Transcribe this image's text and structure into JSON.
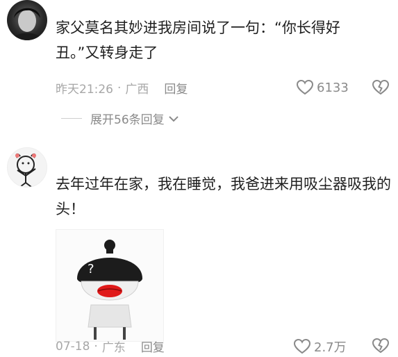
{
  "comments": [
    {
      "text": "家父莫名其妙进我房间说了一句：“你长得好丑。”又转身走了",
      "time": "昨天21:26",
      "location": "广西",
      "reply_label": "回复",
      "likes": "6133",
      "expand_replies": "展开56条回复"
    },
    {
      "text": "去年过年在家，我在睡觉，我爸进来用吸尘器吸我的头！",
      "sticker_mark": "?",
      "time": "07-18",
      "location": "广东",
      "reply_label": "回复",
      "likes": "2.7万"
    }
  ],
  "separator": "·",
  "icons": [
    "heart-icon",
    "heart-broken-icon",
    "chevron-down-icon"
  ]
}
